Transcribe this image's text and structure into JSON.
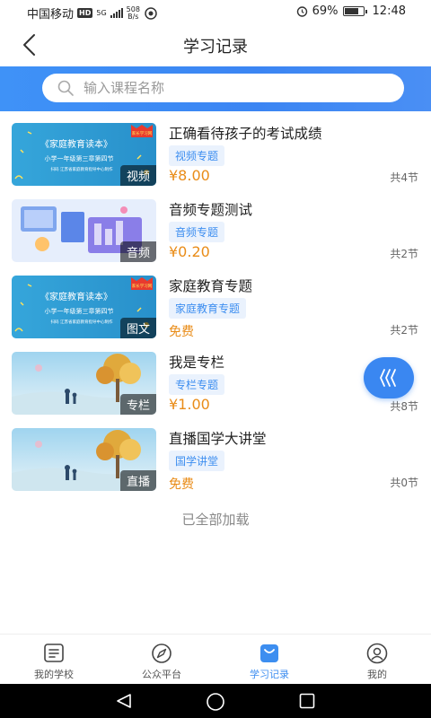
{
  "status_bar": {
    "carrier": "中国移动",
    "hd": "HD",
    "net": "5G",
    "speed_value": "508",
    "speed_unit": "B/s",
    "battery": "69%",
    "battery_level": 0.69,
    "time": "12:48"
  },
  "header": {
    "title": "学习记录"
  },
  "search": {
    "placeholder": "输入课程名称"
  },
  "courses": [
    {
      "title": "正确看待孩子的考试成绩",
      "type_tag": "视频",
      "topic": "视频专题",
      "price": "¥8.00",
      "count": "共4节"
    },
    {
      "title": "音频专题测试",
      "type_tag": "音频",
      "topic": "音频专题",
      "price": "¥0.20",
      "count": "共2节"
    },
    {
      "title": "家庭教育专题",
      "type_tag": "图文",
      "topic": "家庭教育专题",
      "price": "免费",
      "count": "共2节"
    },
    {
      "title": "我是专栏",
      "type_tag": "专栏",
      "topic": "专栏专题",
      "price": "¥1.00",
      "count": "共8节"
    },
    {
      "title": "直播国学大讲堂",
      "type_tag": "直播",
      "topic": "国学讲堂",
      "price": "免费",
      "count": "共0节"
    }
  ],
  "thumbnail_text": {
    "book_title": "《家庭教育读本》",
    "book_subtitle": "小学一年级第三章第四节",
    "book_footer": "扫码 江苏省家庭教育指导中心制作",
    "book_badge": "家长学习网"
  },
  "list_footer": "已全部加载",
  "tabbar": [
    {
      "label": "我的学校",
      "icon": "school-icon",
      "active": false
    },
    {
      "label": "公众平台",
      "icon": "compass-icon",
      "active": false
    },
    {
      "label": "学习记录",
      "icon": "bag-icon",
      "active": true
    },
    {
      "label": "我的",
      "icon": "user-icon",
      "active": false
    }
  ],
  "colors": {
    "accent": "#3d8ef0",
    "price": "#e98c18",
    "search_band": "#3b85f3"
  }
}
